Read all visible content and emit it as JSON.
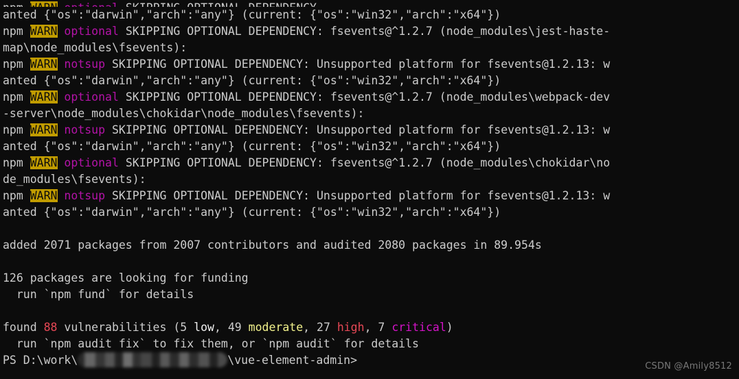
{
  "terminal": {
    "shell": "PowerShell",
    "background_color": "#0c0c0c",
    "foreground_color": "#cccccc",
    "colors": {
      "warn_badge_bg": "#c19c00",
      "warn_badge_fg": "#0c0c0c",
      "purple": "#b413a8",
      "red": "#e74856",
      "yellow": "#f2f28c",
      "magenta": "#d413c8",
      "bright_white": "#f2f2f2"
    },
    "clipped_top_line": "npm WARN optional SKIPPING OPTIONAL DEPENDENCY",
    "lines": {
      "l1": "anted {\"os\":\"darwin\",\"arch\":\"any\"} (current: {\"os\":\"win32\",\"arch\":\"x64\"})",
      "l2_npm": "npm ",
      "l2_warn": "WARN",
      "l2_kind": " optional ",
      "l2_rest": "SKIPPING OPTIONAL DEPENDENCY: fsevents@^1.2.7 (node_modules\\jest-haste-",
      "l3": "map\\node_modules\\fsevents):",
      "l4_npm": "npm ",
      "l4_warn": "WARN",
      "l4_kind": " notsup ",
      "l4_rest": "SKIPPING OPTIONAL DEPENDENCY: Unsupported platform for fsevents@1.2.13: w",
      "l5": "anted {\"os\":\"darwin\",\"arch\":\"any\"} (current: {\"os\":\"win32\",\"arch\":\"x64\"})",
      "l6_npm": "npm ",
      "l6_warn": "WARN",
      "l6_kind": " optional ",
      "l6_rest": "SKIPPING OPTIONAL DEPENDENCY: fsevents@^1.2.7 (node_modules\\webpack-dev",
      "l7": "-server\\node_modules\\chokidar\\node_modules\\fsevents):",
      "l8_npm": "npm ",
      "l8_warn": "WARN",
      "l8_kind": " notsup ",
      "l8_rest": "SKIPPING OPTIONAL DEPENDENCY: Unsupported platform for fsevents@1.2.13: w",
      "l9": "anted {\"os\":\"darwin\",\"arch\":\"any\"} (current: {\"os\":\"win32\",\"arch\":\"x64\"})",
      "l10_npm": "npm ",
      "l10_warn": "WARN",
      "l10_kind": " optional ",
      "l10_rest": "SKIPPING OPTIONAL DEPENDENCY: fsevents@^1.2.7 (node_modules\\chokidar\\no",
      "l11": "de_modules\\fsevents):",
      "l12_npm": "npm ",
      "l12_warn": "WARN",
      "l12_kind": " notsup ",
      "l12_rest": "SKIPPING OPTIONAL DEPENDENCY: Unsupported platform for fsevents@1.2.13: w",
      "l13": "anted {\"os\":\"darwin\",\"arch\":\"any\"} (current: {\"os\":\"win32\",\"arch\":\"x64\"})",
      "l14": "",
      "l15": "added 2071 packages from 2007 contributors and audited 2080 packages in 89.954s",
      "l16": "",
      "l17": "126 packages are looking for funding",
      "l18": "  run `npm fund` for details",
      "l19": "",
      "vuln_found": "found ",
      "vuln_count": "88",
      "vuln_mid": " vulnerabilities (5 ",
      "vuln_low": "low",
      "vuln_sep1": ", 49 ",
      "vuln_moderate": "moderate",
      "vuln_sep2": ", 27 ",
      "vuln_high": "high",
      "vuln_sep3": ", 7 ",
      "vuln_critical": "critical",
      "vuln_end": ")",
      "l21": "  run `npm audit fix` to fix them, or `npm audit` for details",
      "prompt_prefix": "PS D:\\work\\",
      "prompt_suffix": "\\vue-element-admin>"
    }
  },
  "watermark": {
    "text": "CSDN @Amily8512"
  }
}
